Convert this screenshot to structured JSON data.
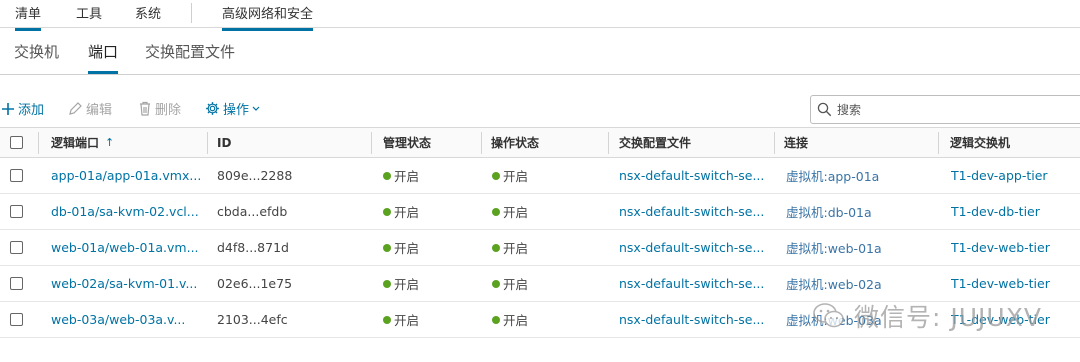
{
  "top_nav": {
    "items": [
      "清单",
      "工具",
      "系统",
      "高级网络和安全"
    ]
  },
  "sub_tabs": [
    "交换机",
    "端口",
    "交换配置文件"
  ],
  "toolbar": {
    "add": "添加",
    "edit": "编辑",
    "delete": "删除",
    "actions": "操作"
  },
  "search": {
    "placeholder": "搜索"
  },
  "table": {
    "columns": [
      "逻辑端口",
      "ID",
      "管理状态",
      "操作状态",
      "交换配置文件",
      "连接",
      "逻辑交换机"
    ],
    "sort_indicator": "↑",
    "rows": [
      {
        "port": "app-01a/app-01a.vmx...",
        "id": "809e...2288",
        "admin": "开启",
        "oper": "开启",
        "profile": "nsx-default-switch-se...",
        "conn": "虚拟机:app-01a",
        "switch": "T1-dev-app-tier"
      },
      {
        "port": "db-01a/sa-kvm-02.vcl...",
        "id": "cbda...efdb",
        "admin": "开启",
        "oper": "开启",
        "profile": "nsx-default-switch-se...",
        "conn": "虚拟机:db-01a",
        "switch": "T1-dev-db-tier"
      },
      {
        "port": "web-01a/web-01a.vm...",
        "id": "d4f8...871d",
        "admin": "开启",
        "oper": "开启",
        "profile": "nsx-default-switch-se...",
        "conn": "虚拟机:web-01a",
        "switch": "T1-dev-web-tier"
      },
      {
        "port": "web-02a/sa-kvm-01.v...",
        "id": "02e6...1e75",
        "admin": "开启",
        "oper": "开启",
        "profile": "nsx-default-switch-se...",
        "conn": "虚拟机:web-02a",
        "switch": "T1-dev-web-tier"
      },
      {
        "port": "web-03a/web-03a.v...",
        "id": "2103...4efc",
        "admin": "开启",
        "oper": "开启",
        "profile": "nsx-default-switch-se...",
        "conn": "虚拟机:web-03a",
        "switch": "T1-dev-web-tier"
      }
    ]
  },
  "watermark": {
    "text": "微信号: JUJUXV"
  },
  "colors": {
    "accent": "#0072a3",
    "status_up": "#5aa220"
  },
  "icons": [
    "plus-icon",
    "pencil-icon",
    "trash-icon",
    "gear-icon",
    "chevron-down-icon",
    "search-icon",
    "wechat-icon"
  ]
}
